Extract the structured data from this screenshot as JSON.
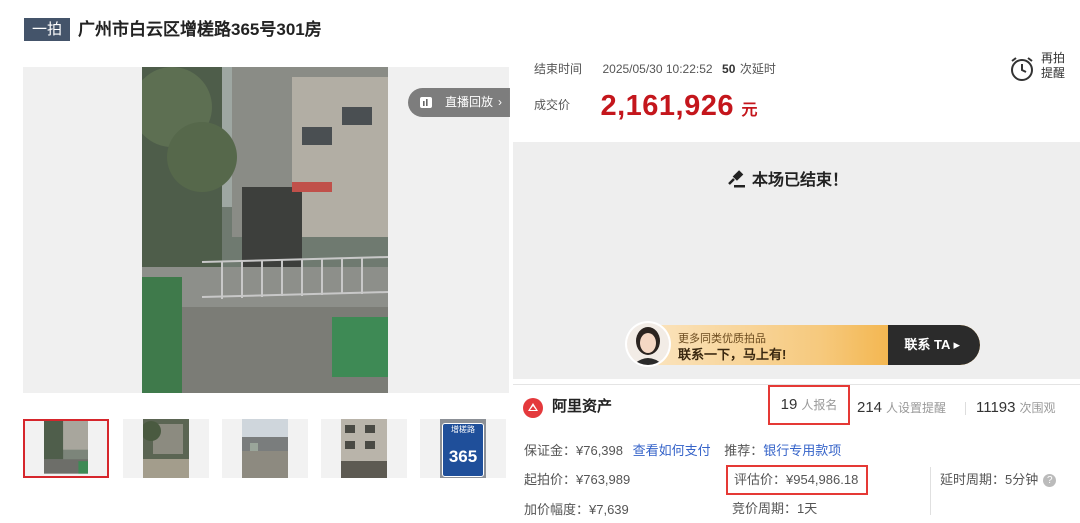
{
  "header": {
    "badge": "一拍",
    "title": "广州市白云区增槎路365号301房"
  },
  "gallery": {
    "live_replay_label": "直播回放",
    "live_replay_arrow": "›",
    "thumbnails": [
      {
        "name": "thumb-1",
        "active": true
      },
      {
        "name": "thumb-2",
        "active": false
      },
      {
        "name": "thumb-3",
        "active": false
      },
      {
        "name": "thumb-4",
        "active": false
      },
      {
        "name": "thumb-5",
        "active": false,
        "plate_top": "增槎路",
        "plate_number": "365"
      }
    ]
  },
  "auction": {
    "end_time_label": "结束时间",
    "end_time_value": "2025/05/30 10:22:52",
    "delay_count": "50",
    "delay_label": "次延时",
    "deal_price_label": "成交价",
    "deal_price": "2,161,926",
    "deal_price_unit": "元",
    "remind_line1": "再拍",
    "remind_line2": "提醒",
    "ended_message": "本场已结束！"
  },
  "promo": {
    "line1": "更多同类优质拍品",
    "line2": "联系一下，马上有!",
    "cta": "联系 TA ▸"
  },
  "stats": {
    "brand": "阿里资产",
    "registered_count": "19",
    "registered_label": "人报名",
    "reminder_count": "214",
    "reminder_label": "人设置提醒",
    "views_count": "11193",
    "views_label": "次围观"
  },
  "details": {
    "deposit": "保证金：¥76,398",
    "how_to_pay": "查看如何支付",
    "recommend_label": "推荐：",
    "recommend_link": "银行专用款项",
    "starting_price": "起拍价：¥763,989",
    "appraisal": "评估价：¥954,986.18",
    "delay_period": "延时周期：5分钟",
    "increment": "加价幅度：¥7,639",
    "bid_period": "竞价周期：1天",
    "help_icon": "?"
  },
  "colors": {
    "accent_red": "#c4161c",
    "highlight_border": "#e53935",
    "link_blue": "#3563c9",
    "badge_bg": "#44546a"
  }
}
